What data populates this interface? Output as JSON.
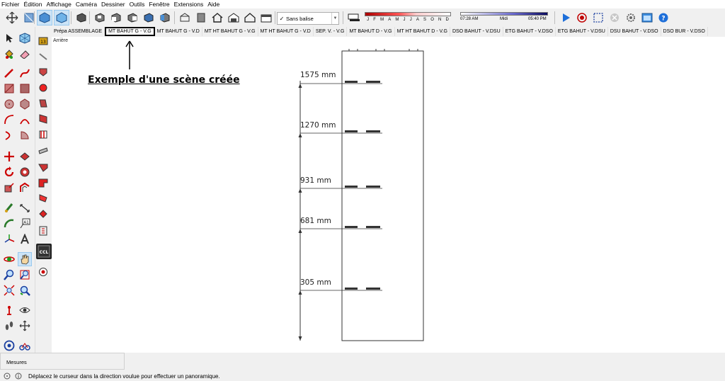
{
  "menu": [
    "Fichier",
    "Édition",
    "Affichage",
    "Caméra",
    "Dessiner",
    "Outils",
    "Fenêtre",
    "Extensions",
    "Aide"
  ],
  "toolbar": {
    "tag_value": "Sans balise",
    "tag_checked": "✓",
    "months": [
      "J",
      "F",
      "M",
      "A",
      "M",
      "J",
      "J",
      "A",
      "S",
      "O",
      "N",
      "D"
    ],
    "time_start": "07:28 AM",
    "time_mid": "Midi",
    "time_end": "05:40 PM"
  },
  "scenes": {
    "tabs": [
      "Prépa ASSEMBLAGE",
      "MT BAHUT G - V.G",
      "MT BAHUT G - V.D",
      "MT HT BAHUT G - V.G",
      "MT HT BAHUT G - V.D",
      "SEP. V. - V.G",
      "MT BAHUT D - V.G",
      "MT HT BAHUT D - V.G",
      "DSO BAHUT - V.DSU",
      "ETG BAHUT - V.DSO",
      "ETG BAHUT - V.DSU",
      "DSU BAHUT - V.DSO",
      "DSO BUR - V.DSO"
    ],
    "active_index": 1
  },
  "viewport": {
    "scene_label": "Arrière",
    "annotation": "Exemple d'une scène créée",
    "dimensions": [
      "1575 mm",
      "1270 mm",
      "931 mm",
      "681 mm",
      "305 mm"
    ]
  },
  "measures_label": "Mesures",
  "status_text": "Déplacez le curseur dans la direction voulue pour effectuer un panoramique.",
  "colors": {
    "accent_active": "#cce4f7",
    "play": "#1e6fd9",
    "record": "#c00000"
  }
}
